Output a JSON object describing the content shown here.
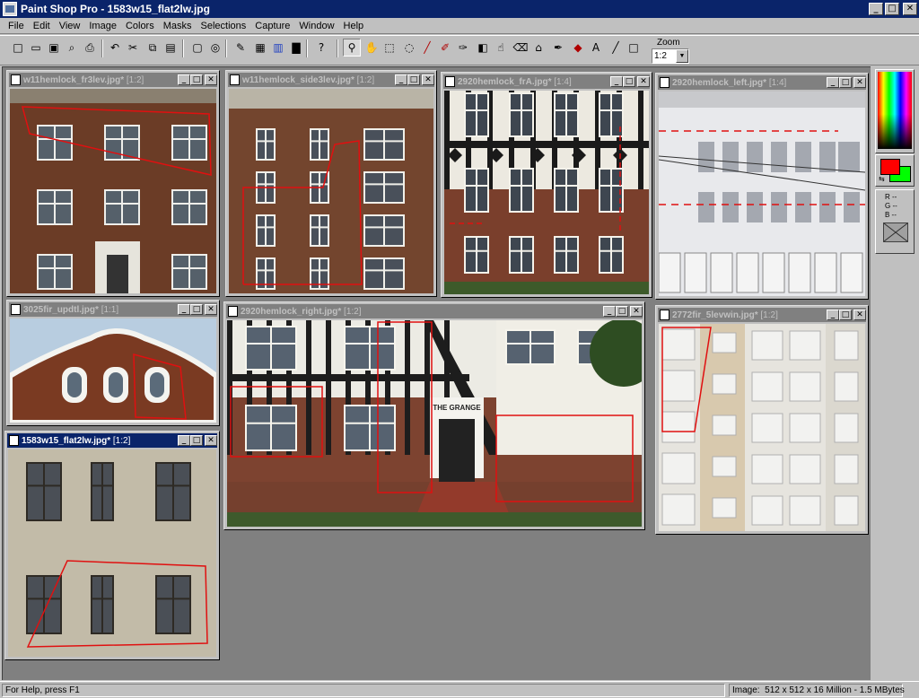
{
  "app": {
    "title": "Paint Shop Pro - 1583w15_flat2lw.jpg",
    "minimize": "_",
    "maximize": "□",
    "close": "✕"
  },
  "menu": [
    "File",
    "Edit",
    "View",
    "Image",
    "Colors",
    "Masks",
    "Selections",
    "Capture",
    "Window",
    "Help"
  ],
  "toolbar": {
    "icons": [
      "new-icon",
      "open-icon",
      "save-icon",
      "print-preview-icon",
      "print-icon",
      "undo-icon",
      "cut-icon",
      "copy-icon",
      "paste-icon",
      "full-screen-icon",
      "browse-icon",
      "control-palette-icon",
      "tool-palette-icon",
      "color-palette-icon",
      "histogram-icon",
      "help-icon",
      "zoom-tool-icon",
      "mover-tool-icon",
      "selection-tool-icon",
      "freehand-tool-icon",
      "dropper-tool-icon",
      "paintbrush-tool-icon",
      "clone-brush-icon",
      "color-replacer-icon",
      "retouch-tool-icon",
      "eraser-tool-icon",
      "picture-tube-icon",
      "airbrush-icon",
      "flood-fill-icon",
      "text-tool-icon",
      "line-tool-icon",
      "shapes-tool-icon"
    ],
    "zoom_label": "Zoom",
    "zoom_value": "1:2"
  },
  "windows": [
    {
      "title": "w11hemlock_fr3lev.jpg*",
      "zoom": "[1:2]",
      "active": false,
      "scene": "brick3"
    },
    {
      "title": "w11hemlock_side3lev.jpg*",
      "zoom": "[1:2]",
      "active": false,
      "scene": "brick4"
    },
    {
      "title": "2920hemlock_frA.jpg*",
      "zoom": "[1:4]",
      "active": false,
      "scene": "tudor"
    },
    {
      "title": "2920hemlock_left.jpg*",
      "zoom": "[1:4]",
      "active": false,
      "scene": "white"
    },
    {
      "title": "3025fir_updtl.jpg*",
      "zoom": "[1:1]",
      "active": false,
      "scene": "gable"
    },
    {
      "title": "2920hemlock_right.jpg*",
      "zoom": "[1:2]",
      "active": false,
      "scene": "grange"
    },
    {
      "title": "2772fir_5levwin.jpg*",
      "zoom": "[1:2]",
      "active": false,
      "scene": "tall"
    },
    {
      "title": "1583w15_flat2lw.jpg*",
      "zoom": "[1:2]",
      "active": true,
      "scene": "stucco"
    }
  ],
  "grange_sign": "THE GRANGE",
  "palette": {
    "foreground": "#ff0000",
    "background": "#00ff00",
    "rgb_r": "R --",
    "rgb_g": "G --",
    "rgb_b": "B --"
  },
  "status": {
    "help": "For Help, press F1",
    "image_info": "Image:  512 x 512 x 16 Million - 1.5 MBytes"
  }
}
